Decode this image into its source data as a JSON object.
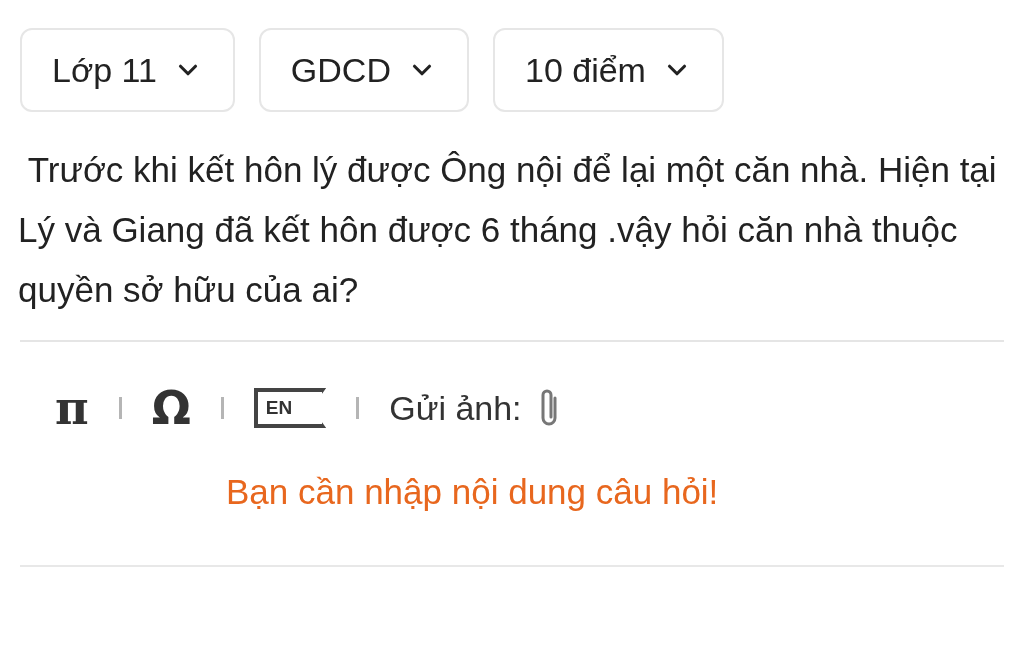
{
  "filters": [
    {
      "label": "Lớp 11"
    },
    {
      "label": "GDCD"
    },
    {
      "label": "10 điểm"
    }
  ],
  "question": " Trước khi kết hôn lý được Ông nội để lại một căn nhà. Hiện tại Lý và Giang đã kết hôn được 6 tháng .vậy hỏi căn nhà thuộc quyền sở hữu của ai?",
  "toolbar": {
    "math_symbol": "π",
    "special_char": "Ω",
    "language_badge": "EN",
    "attach_label": "Gửi ảnh:"
  },
  "error_message": "Bạn cần nhập nội dung câu hỏi!"
}
